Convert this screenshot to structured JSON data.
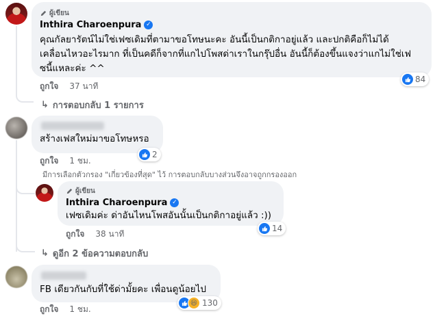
{
  "author_badge": "ผู้เขียน",
  "comment1": {
    "name": "Inthira Charoenpura",
    "lines": [
      "คุณกัลยารัตน์ไม่ใช่เฟซเดิมที่ตามาขอโทษนะคะ อันนี้เป็นกติกาอยู่แล้ว และปกติคือก็ไม่ได้",
      "เคลื่อนไหวอะไรมาก ที่เป็นคดีก็จากที่แกไปโพสด่าเราในกรุ๊ปอื่น อันนี้ก็ต้องขึ้นแจงว่าแกไม่ใช่เฟ",
      "ซนี้แหละค่ะ ^^"
    ],
    "like_label": "ถูกใจ",
    "time": "37 นาที",
    "reaction_count": "84"
  },
  "replies_link1": "การตอบกลับ 1 รายการ",
  "comment2": {
    "text": "สร้างเฟสใหม่มาขอโทษหรอ",
    "like_label": "ถูกใจ",
    "time": "1 ชม.",
    "reaction_count": "2"
  },
  "filter_notice": "มีการเลือกตัวกรอง \"เกี่ยวข้องที่สุด\" ไว้ การตอบกลับบางส่วนจึงอาจถูกกรองออก",
  "reply1": {
    "name": "Inthira Charoenpura",
    "text": "เฟซเดิมค่ะ ด่าอันไหนโพสอันนั้นเป็นกติกาอยู่แล้ว :))",
    "like_label": "ถูกใจ",
    "time": "38 นาที",
    "reaction_count": "14"
  },
  "more_replies": "ดูอีก 2 ข้อความตอบกลับ",
  "comment3": {
    "text": "FB เดียวกันกับที่ใช้ด่ามั้ยคะ เพื่อนดูน้อยไป",
    "like_label": "ถูกใจ",
    "time": "1 ชม.",
    "reaction_count": "130"
  }
}
